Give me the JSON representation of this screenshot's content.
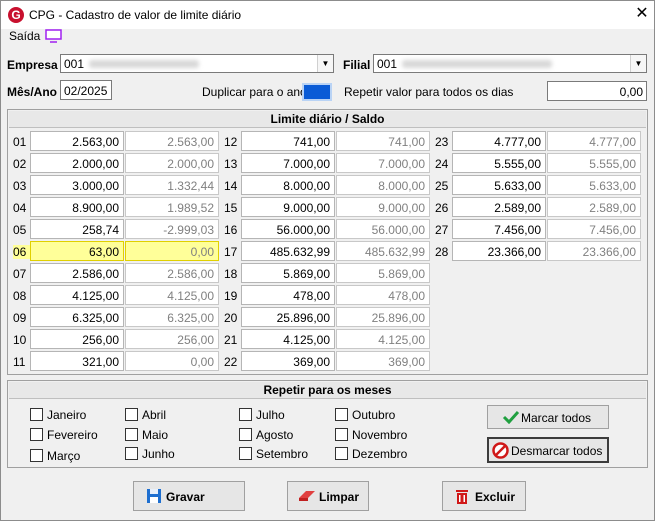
{
  "window": {
    "title": "CPG - Cadastro de valor de limite diário",
    "close_glyph": "✕"
  },
  "menu": {
    "saida": "Saída"
  },
  "empresa": {
    "label": "Empresa",
    "code": "001"
  },
  "filial": {
    "label": "Filial",
    "code": "001"
  },
  "mes_ano": {
    "label": "Mês/Ano",
    "value": "02/2025"
  },
  "duplicar": {
    "label": "Duplicar para o ano"
  },
  "repetir_valor": {
    "label": "Repetir valor para todos os dias",
    "value": "0,00"
  },
  "limite_panel": {
    "header": "Limite diário / Saldo"
  },
  "days": [
    {
      "n": "01",
      "limite": "2.563,00",
      "saldo": "2.563,00"
    },
    {
      "n": "02",
      "limite": "2.000,00",
      "saldo": "2.000,00"
    },
    {
      "n": "03",
      "limite": "3.000,00",
      "saldo": "1.332,44"
    },
    {
      "n": "04",
      "limite": "8.900,00",
      "saldo": "1.989,52"
    },
    {
      "n": "05",
      "limite": "258,74",
      "saldo": "-2.999,03"
    },
    {
      "n": "06",
      "limite": "63,00",
      "saldo": "0,00"
    },
    {
      "n": "07",
      "limite": "2.586,00",
      "saldo": "2.586,00"
    },
    {
      "n": "08",
      "limite": "4.125,00",
      "saldo": "4.125,00"
    },
    {
      "n": "09",
      "limite": "6.325,00",
      "saldo": "6.325,00"
    },
    {
      "n": "10",
      "limite": "256,00",
      "saldo": "256,00"
    },
    {
      "n": "11",
      "limite": "321,00",
      "saldo": "0,00"
    },
    {
      "n": "12",
      "limite": "741,00",
      "saldo": "741,00"
    },
    {
      "n": "13",
      "limite": "7.000,00",
      "saldo": "7.000,00"
    },
    {
      "n": "14",
      "limite": "8.000,00",
      "saldo": "8.000,00"
    },
    {
      "n": "15",
      "limite": "9.000,00",
      "saldo": "9.000,00"
    },
    {
      "n": "16",
      "limite": "56.000,00",
      "saldo": "56.000,00"
    },
    {
      "n": "17",
      "limite": "485.632,99",
      "saldo": "485.632,99"
    },
    {
      "n": "18",
      "limite": "5.869,00",
      "saldo": "5.869,00"
    },
    {
      "n": "19",
      "limite": "478,00",
      "saldo": "478,00"
    },
    {
      "n": "20",
      "limite": "25.896,00",
      "saldo": "25.896,00"
    },
    {
      "n": "21",
      "limite": "4.125,00",
      "saldo": "4.125,00"
    },
    {
      "n": "22",
      "limite": "369,00",
      "saldo": "369,00"
    },
    {
      "n": "23",
      "limite": "4.777,00",
      "saldo": "4.777,00"
    },
    {
      "n": "24",
      "limite": "5.555,00",
      "saldo": "5.555,00"
    },
    {
      "n": "25",
      "limite": "5.633,00",
      "saldo": "5.633,00"
    },
    {
      "n": "26",
      "limite": "2.589,00",
      "saldo": "2.589,00"
    },
    {
      "n": "27",
      "limite": "7.456,00",
      "saldo": "7.456,00"
    },
    {
      "n": "28",
      "limite": "23.366,00",
      "saldo": "23.366,00"
    }
  ],
  "meses_panel": {
    "header": "Repetir para os meses"
  },
  "months": [
    "Janeiro",
    "Fevereiro",
    "Março",
    "Abril",
    "Maio",
    "Junho",
    "Julho",
    "Agosto",
    "Setembro",
    "Outubro",
    "Novembro",
    "Dezembro"
  ],
  "buttons": {
    "marcar_todos": "Marcar todos",
    "desmarcar_todos": "Desmarcar todos",
    "gravar": "Gravar",
    "limpar": "Limpar",
    "excluir": "Excluir"
  },
  "colors": {
    "highlight": "#ffff99",
    "accent_blue": "#0a5bd6",
    "brand_red": "#c8102e"
  }
}
